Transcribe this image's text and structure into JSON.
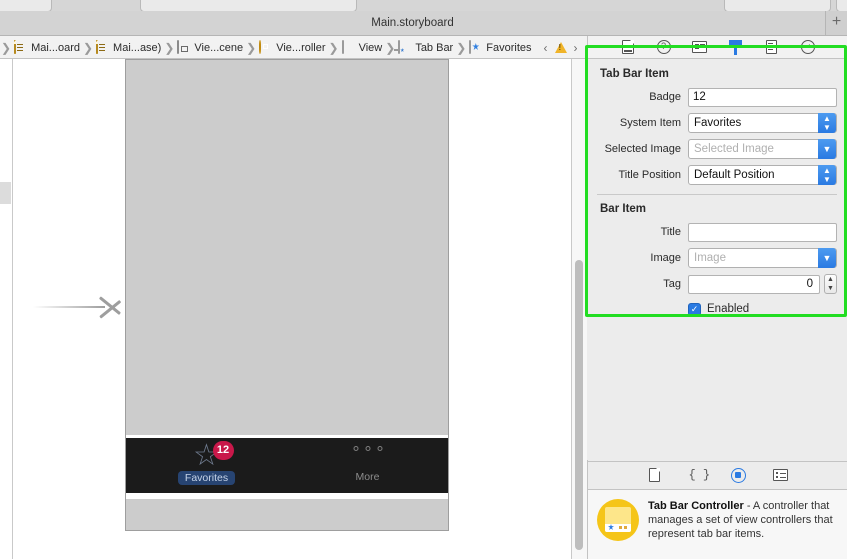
{
  "window": {
    "tab_title": "Main.storyboard",
    "add_tab_label": "+"
  },
  "breadcrumb": {
    "items": [
      {
        "icon": "document-icon",
        "label": "Mai...oard"
      },
      {
        "icon": "document-icon",
        "label": "Mai...ase)"
      },
      {
        "icon": "scene-icon",
        "label": "Vie...cene"
      },
      {
        "icon": "view-controller-icon",
        "label": "Vie...roller"
      },
      {
        "icon": "view-icon",
        "label": "View"
      },
      {
        "icon": "tab-bar-icon",
        "label": "Tab Bar"
      },
      {
        "icon": "star-icon",
        "label": "Favorites"
      }
    ],
    "prev_label": "‹",
    "next_label": "›",
    "warning_icon": "warning-triangle-icon"
  },
  "canvas": {
    "tab_bar": {
      "items": [
        {
          "label": "Favorites",
          "icon": "star-outline-icon",
          "badge": "12",
          "selected": true
        },
        {
          "label": "More",
          "icon": "ellipsis-icon",
          "badge": "",
          "selected": false
        }
      ]
    }
  },
  "inspector": {
    "toolbar_icons": [
      {
        "name": "file-inspector-icon",
        "active": false
      },
      {
        "name": "quick-help-icon",
        "active": false
      },
      {
        "name": "identity-inspector-icon",
        "active": false
      },
      {
        "name": "attributes-inspector-icon",
        "active": true
      },
      {
        "name": "size-inspector-icon",
        "active": false
      },
      {
        "name": "connections-inspector-icon",
        "active": false
      }
    ],
    "sections": [
      {
        "title": "Tab Bar Item",
        "fields": [
          {
            "label": "Badge",
            "type": "text",
            "value": "12",
            "placeholder": ""
          },
          {
            "label": "System Item",
            "type": "popup",
            "value": "Favorites"
          },
          {
            "label": "Selected Image",
            "type": "combo",
            "value": "",
            "placeholder": "Selected Image"
          },
          {
            "label": "Title Position",
            "type": "popup",
            "value": "Default Position"
          }
        ]
      },
      {
        "title": "Bar Item",
        "fields": [
          {
            "label": "Title",
            "type": "text",
            "value": "",
            "placeholder": ""
          },
          {
            "label": "Image",
            "type": "combo",
            "value": "",
            "placeholder": "Image"
          },
          {
            "label": "Tag",
            "type": "stepper",
            "value": "0"
          },
          {
            "label": "Enabled",
            "type": "checkbox",
            "checked": true
          }
        ]
      }
    ],
    "highlight_color": "#22dd22"
  },
  "library": {
    "toolbar_icons": [
      {
        "name": "file-template-library-icon",
        "active": false
      },
      {
        "name": "code-snippet-library-icon",
        "active": false
      },
      {
        "name": "object-library-icon",
        "active": true
      },
      {
        "name": "media-library-icon",
        "active": false
      }
    ],
    "description": {
      "icon": "tab-bar-controller-icon",
      "title": "Tab Bar Controller",
      "body": " - A controller that manages a set of view controllers that represent tab bar items."
    }
  }
}
